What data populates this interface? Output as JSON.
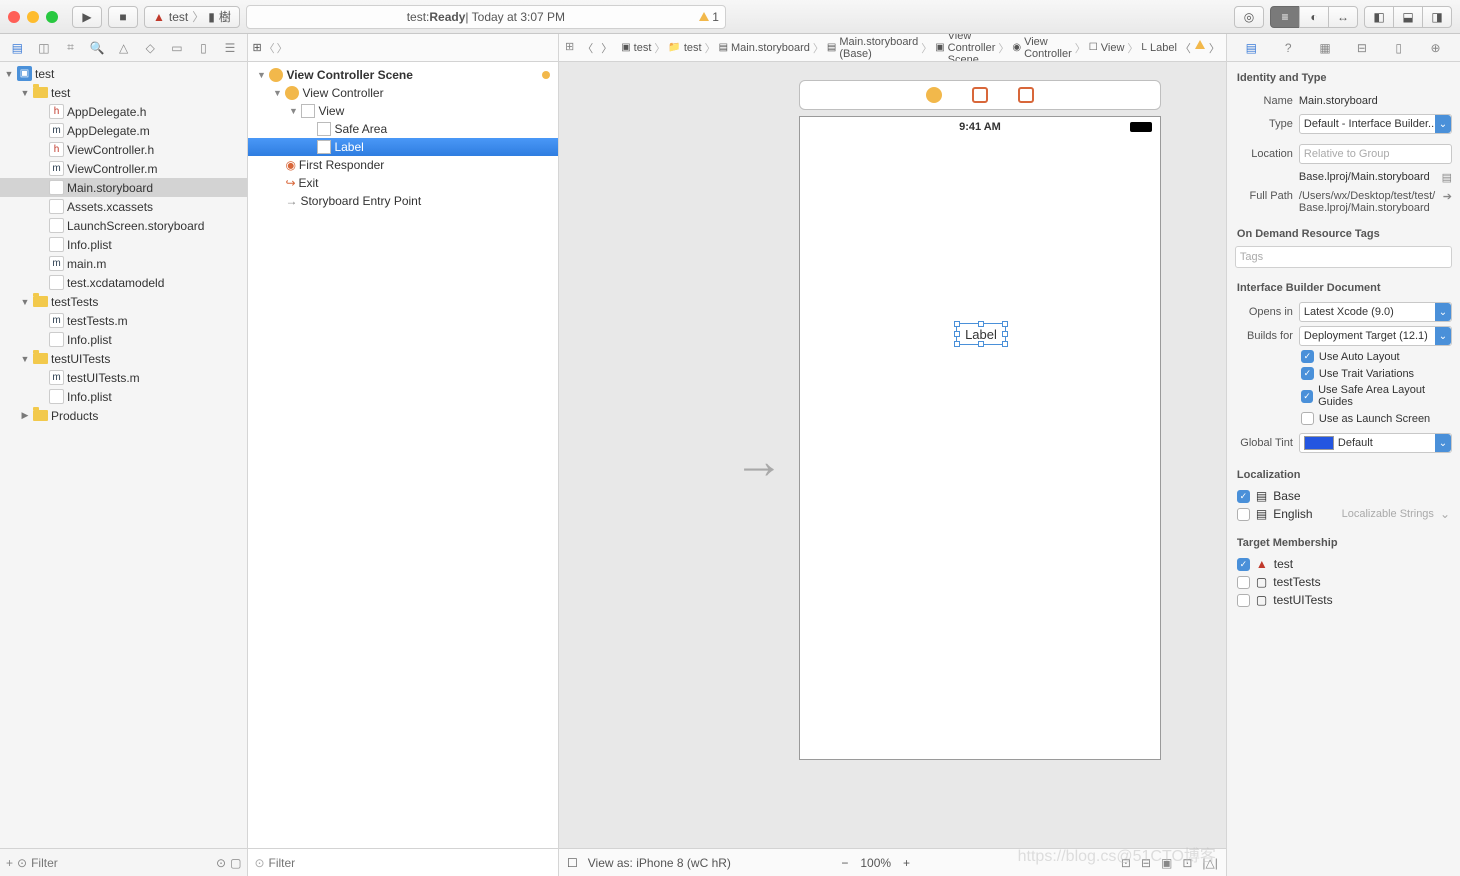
{
  "toolbar": {
    "scheme": "test",
    "device": "樹",
    "status_prefix": "test: ",
    "status_state": "Ready",
    "status_time": " | Today at 3:07 PM",
    "warn_count": "1"
  },
  "navigator": {
    "filter_placeholder": "Filter",
    "tree": [
      {
        "indent": 0,
        "disc": "▼",
        "icon": "proj",
        "label": "test"
      },
      {
        "indent": 1,
        "disc": "▼",
        "icon": "folder",
        "label": "test"
      },
      {
        "indent": 2,
        "disc": "",
        "icon": "h",
        "label": "AppDelegate.h"
      },
      {
        "indent": 2,
        "disc": "",
        "icon": "m",
        "label": "AppDelegate.m"
      },
      {
        "indent": 2,
        "disc": "",
        "icon": "h",
        "label": "ViewController.h"
      },
      {
        "indent": 2,
        "disc": "",
        "icon": "m",
        "label": "ViewController.m"
      },
      {
        "indent": 2,
        "disc": "",
        "icon": "sb",
        "label": "Main.storyboard",
        "sel": true
      },
      {
        "indent": 2,
        "disc": "",
        "icon": "sb",
        "label": "Assets.xcassets"
      },
      {
        "indent": 2,
        "disc": "",
        "icon": "sb",
        "label": "LaunchScreen.storyboard"
      },
      {
        "indent": 2,
        "disc": "",
        "icon": "plist",
        "label": "Info.plist"
      },
      {
        "indent": 2,
        "disc": "",
        "icon": "m",
        "label": "main.m"
      },
      {
        "indent": 2,
        "disc": "",
        "icon": "sb",
        "label": "test.xcdatamodeld"
      },
      {
        "indent": 1,
        "disc": "▼",
        "icon": "folder",
        "label": "testTests"
      },
      {
        "indent": 2,
        "disc": "",
        "icon": "m",
        "label": "testTests.m"
      },
      {
        "indent": 2,
        "disc": "",
        "icon": "plist",
        "label": "Info.plist"
      },
      {
        "indent": 1,
        "disc": "▼",
        "icon": "folder",
        "label": "testUITests"
      },
      {
        "indent": 2,
        "disc": "",
        "icon": "m",
        "label": "testUITests.m"
      },
      {
        "indent": 2,
        "disc": "",
        "icon": "plist",
        "label": "Info.plist"
      },
      {
        "indent": 1,
        "disc": "▶",
        "icon": "folder",
        "label": "Products"
      }
    ]
  },
  "outline": {
    "header": "View Controller Scene",
    "filter_placeholder": "Filter",
    "items": [
      {
        "indent": 0,
        "disc": "▼",
        "icon": "scene",
        "label": "View Controller Scene",
        "warn": true
      },
      {
        "indent": 1,
        "disc": "▼",
        "icon": "vc",
        "label": "View Controller"
      },
      {
        "indent": 2,
        "disc": "▼",
        "icon": "view",
        "label": "View"
      },
      {
        "indent": 3,
        "disc": "",
        "icon": "safe",
        "label": "Safe Area"
      },
      {
        "indent": 3,
        "disc": "",
        "icon": "lbl",
        "label": "Label",
        "sel": true
      },
      {
        "indent": 1,
        "disc": "",
        "icon": "first",
        "label": "First Responder"
      },
      {
        "indent": 1,
        "disc": "",
        "icon": "exit",
        "label": "Exit"
      },
      {
        "indent": 1,
        "disc": "",
        "icon": "entry",
        "label": "Storyboard Entry Point"
      }
    ]
  },
  "jumpbar": {
    "segs": [
      "test",
      "test",
      "Main.storyboard",
      "Main.storyboard (Base)",
      "View Controller Scene",
      "View Controller",
      "View",
      "Label"
    ]
  },
  "canvas": {
    "time": "9:41 AM",
    "selected_label_text": "Label",
    "view_as": "View as: iPhone 8 (wC hR)",
    "zoom": "100%"
  },
  "inspector": {
    "sections": {
      "identity": "Identity and Type",
      "ondemand": "On Demand Resource Tags",
      "ibdoc": "Interface Builder Document",
      "localization": "Localization",
      "target": "Target Membership"
    },
    "name_lbl": "Name",
    "name_val": "Main.storyboard",
    "type_lbl": "Type",
    "type_val": "Default - Interface Builder...",
    "location_lbl": "Location",
    "location_val": "Relative to Group",
    "location_path": "Base.lproj/Main.storyboard",
    "fullpath_lbl": "Full Path",
    "fullpath_val": "/Users/wx/Desktop/test/test/Base.lproj/Main.storyboard",
    "tags_placeholder": "Tags",
    "opensin_lbl": "Opens in",
    "opensin_val": "Latest Xcode (9.0)",
    "buildsfor_lbl": "Builds for",
    "buildsfor_val": "Deployment Target (12.1)",
    "chk_autolayout": "Use Auto Layout",
    "chk_trait": "Use Trait Variations",
    "chk_safearea": "Use Safe Area Layout Guides",
    "chk_launch": "Use as Launch Screen",
    "tint_lbl": "Global Tint",
    "tint_val": "Default",
    "loc_base": "Base",
    "loc_english": "English",
    "loc_strings": "Localizable Strings",
    "tm_test": "test",
    "tm_testTests": "testTests",
    "tm_testUI": "testUITests"
  }
}
